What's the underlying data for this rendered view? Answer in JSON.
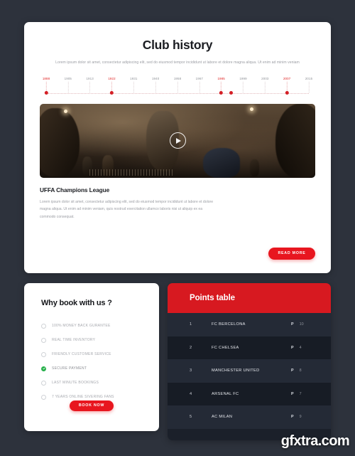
{
  "theme": {
    "page_background": "#2d323c",
    "accent_red": "#e8161f",
    "header_red": "#d71920",
    "success_green": "#27b04b",
    "card_white": "#ffffff",
    "table_row_light": "#242a36",
    "table_row_dark": "#171c25"
  },
  "history": {
    "title": "Club history",
    "subtitle": "Lorem ipsum dolor sit amet, consectetur adipiscing elit, sed do eiusmod tempor incididunt ut labore et dolore magna aliqua. Ut enim ad minim veniam",
    "timeline": [
      {
        "year": "1888",
        "highlighted": true,
        "dot": true
      },
      {
        "year": "1905",
        "highlighted": false,
        "dot": false
      },
      {
        "year": "1913",
        "highlighted": false,
        "dot": false
      },
      {
        "year": "1922",
        "highlighted": true,
        "dot": true
      },
      {
        "year": "1931",
        "highlighted": false,
        "dot": false
      },
      {
        "year": "1940",
        "highlighted": false,
        "dot": false
      },
      {
        "year": "1958",
        "highlighted": false,
        "dot": false
      },
      {
        "year": "1967",
        "highlighted": false,
        "dot": false
      },
      {
        "year": "1985",
        "highlighted": true,
        "dot": true
      },
      {
        "year": "1999",
        "highlighted": false,
        "dot": false
      },
      {
        "year": "2003",
        "highlighted": false,
        "dot": false
      },
      {
        "year": "2007",
        "highlighted": true,
        "dot": true
      },
      {
        "year": "2015",
        "highlighted": false,
        "dot": false
      }
    ],
    "video": {
      "play_icon": "play-icon",
      "alt": "rugby players running in dramatic dusk light"
    },
    "caption_title": "UFFA Champions League",
    "caption_body": "Lorem ipsum dolor sit amet, consectetur adipiscing elit, sed do eiusmod tempor incididunt ut labore et dolore magna aliqua. Ut enim ad minim veniam, quis nostrud exercitation ullamco laboris nisi ut aliquip ex ea commodo consequat.",
    "read_more_label": "READ MORE"
  },
  "why_book": {
    "title": "Why book with us ?",
    "items": [
      {
        "label": "100% MONEY BACK GURANTEE",
        "checked": false
      },
      {
        "label": "REAL TIME INVENTORY",
        "checked": false
      },
      {
        "label": "FRIENDLY CUSTOMER SERVICE",
        "checked": false
      },
      {
        "label": "SECURE PAYMENT",
        "checked": true
      },
      {
        "label": "LAST MINUTE BOOKINGS",
        "checked": false
      },
      {
        "label": "7 YEARS ONLINE SIVERING FANS",
        "checked": false
      }
    ],
    "book_now_label": "BOOK NOW"
  },
  "points_table": {
    "title": "Points table",
    "point_label": "P",
    "rows": [
      {
        "rank": "1",
        "team": "FC BERCELONA",
        "points": "10"
      },
      {
        "rank": "2",
        "team": "FC CHELSEA",
        "points": "4"
      },
      {
        "rank": "3",
        "team": "MANCHESTER UNITED",
        "points": "8"
      },
      {
        "rank": "4",
        "team": "ARSENAL FC",
        "points": "7"
      },
      {
        "rank": "5",
        "team": "AC MILAN",
        "points": "9"
      }
    ]
  },
  "watermark": {
    "text": "gfxtra.com"
  }
}
